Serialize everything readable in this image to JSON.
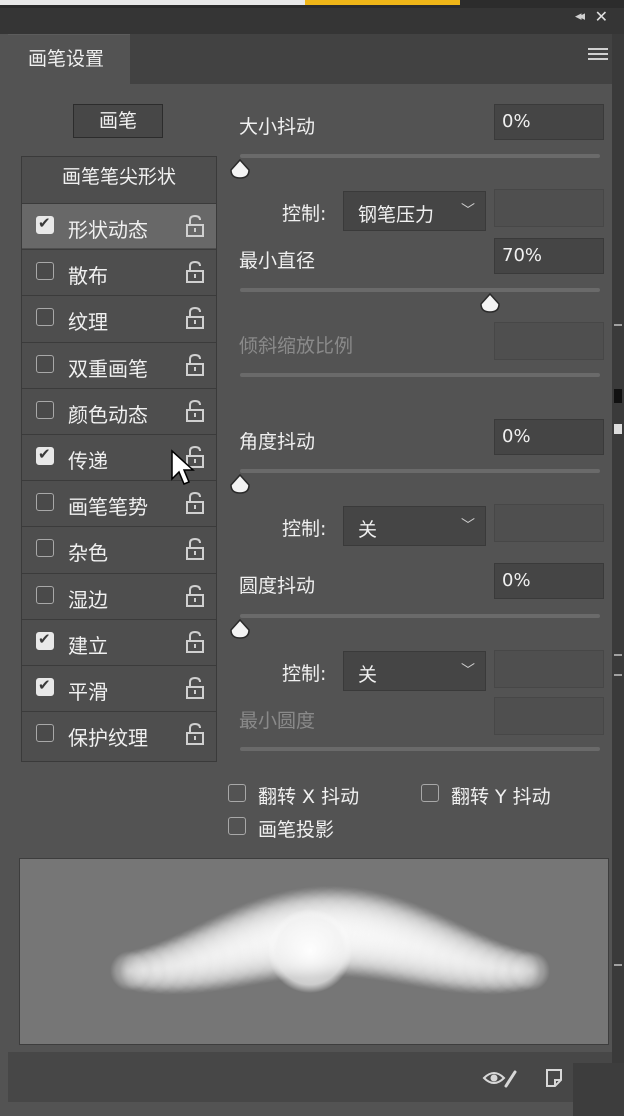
{
  "panel": {
    "tab_label": "画笔设置",
    "collapse_icon": "double-chevron-left-icon",
    "close_icon": "close-icon",
    "menu_icon": "hamburger-menu-icon"
  },
  "left": {
    "brush_button": "画笔",
    "tip_shape": "画笔笔尖形状",
    "options": [
      {
        "label": "形状动态",
        "checked": true,
        "selected": true
      },
      {
        "label": "散布",
        "checked": false
      },
      {
        "label": "纹理",
        "checked": false
      },
      {
        "label": "双重画笔",
        "checked": false
      },
      {
        "label": "颜色动态",
        "checked": false
      },
      {
        "label": "传递",
        "checked": true
      },
      {
        "label": "画笔笔势",
        "checked": false
      },
      {
        "label": "杂色",
        "checked": false
      },
      {
        "label": "湿边",
        "checked": false
      },
      {
        "label": "建立",
        "checked": true
      },
      {
        "label": "平滑",
        "checked": true
      },
      {
        "label": "保护纹理",
        "checked": false
      }
    ]
  },
  "settings": {
    "size_jitter": {
      "label": "大小抖动",
      "value": "0%",
      "level": 0
    },
    "size_control": {
      "label": "控制:",
      "value": "钢笔压力"
    },
    "min_diameter": {
      "label": "最小直径",
      "value": "70%",
      "level": 0.7
    },
    "tilt_scale": {
      "label": "倾斜缩放比例"
    },
    "angle_jitter": {
      "label": "角度抖动",
      "value": "0%",
      "level": 0
    },
    "angle_control": {
      "label": "控制:",
      "value": "关"
    },
    "roundness_jitter": {
      "label": "圆度抖动",
      "value": "0%",
      "level": 0
    },
    "roundness_control": {
      "label": "控制:",
      "value": "关"
    },
    "min_roundness": {
      "label": "最小圆度"
    },
    "flip_x": {
      "label": "翻转 X 抖动",
      "checked": false
    },
    "flip_y": {
      "label": "翻转 Y 抖动",
      "checked": false
    },
    "brush_projection": {
      "label": "画笔投影",
      "checked": false
    }
  },
  "footer": {
    "preview_toggle_icon": "eye-brush-icon",
    "new_preset_icon": "new-preset-icon"
  }
}
